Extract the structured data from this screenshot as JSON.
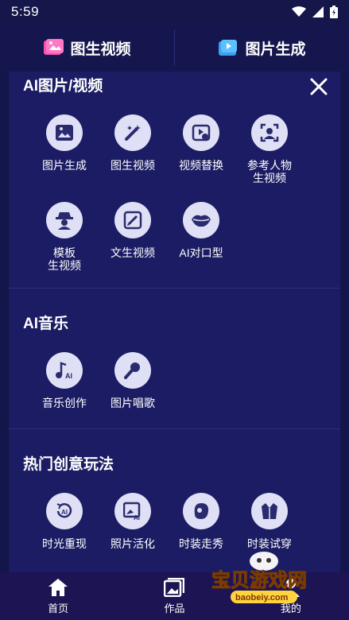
{
  "status": {
    "time": "5:59"
  },
  "top_tabs": [
    {
      "label": "图生视频",
      "icon": "image-video-icon"
    },
    {
      "label": "图片生成",
      "icon": "image-gen-icon"
    }
  ],
  "sections": [
    {
      "title": "AI图片/视频",
      "items": [
        {
          "label": "图片生成",
          "icon": "picture-icon"
        },
        {
          "label": "图生视频",
          "icon": "magic-wand-icon"
        },
        {
          "label": "视频替换",
          "icon": "video-swap-icon"
        },
        {
          "label": "参考人物\n生视频",
          "icon": "portrait-scan-icon"
        },
        {
          "label": "模板\n生视频",
          "icon": "spy-hat-icon"
        },
        {
          "label": "文生视频",
          "icon": "edit-text-icon"
        },
        {
          "label": "AI对口型",
          "icon": "lips-icon"
        }
      ]
    },
    {
      "title": "AI音乐",
      "items": [
        {
          "label": "音乐创作",
          "icon": "music-ai-icon"
        },
        {
          "label": "图片唱歌",
          "icon": "microphone-icon"
        }
      ]
    },
    {
      "title": "热门创意玩法",
      "items": [
        {
          "label": "时光重现",
          "icon": "time-reverse-icon"
        },
        {
          "label": "照片活化",
          "icon": "photo-ai-icon"
        },
        {
          "label": "时装走秀",
          "icon": "fashion-face-icon"
        },
        {
          "label": "时装试穿",
          "icon": "suit-icon"
        }
      ]
    }
  ],
  "bottom_nav": [
    {
      "label": "首页",
      "icon": "home-icon"
    },
    {
      "label": "作品",
      "icon": "gallery-icon"
    },
    {
      "label": "我的",
      "icon": "profile-icon"
    }
  ],
  "watermark": {
    "line1": "宝贝游戏网",
    "line2": "baobeiy.com"
  }
}
